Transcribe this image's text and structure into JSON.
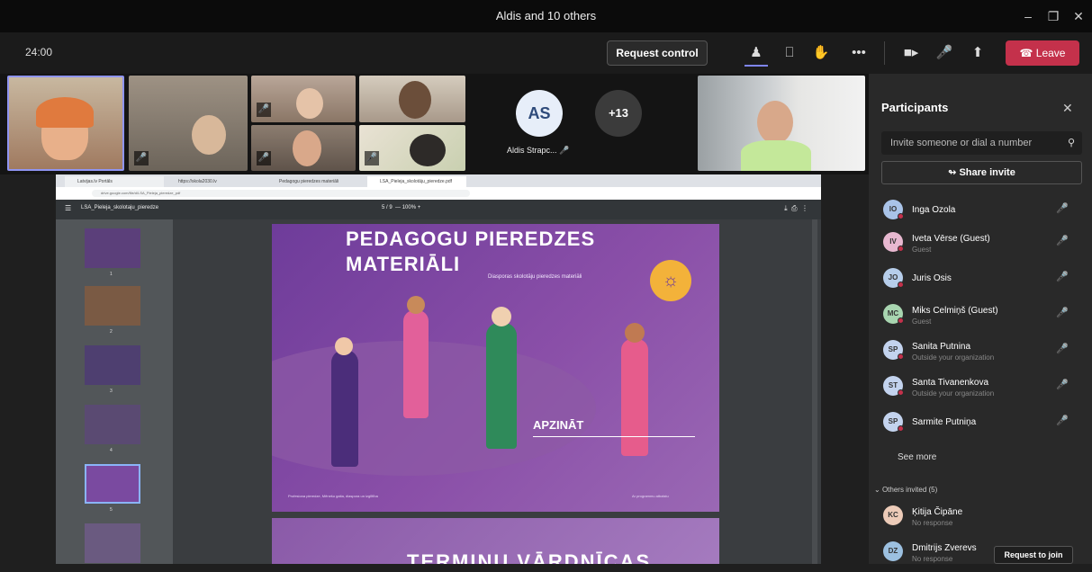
{
  "window": {
    "title": "Aldis and 10 others"
  },
  "toolbar": {
    "timer": "24:00",
    "request_control": "Request control",
    "leave": "Leave"
  },
  "videos": {
    "avatar_initials": "AS",
    "avatar_name": "Aldis Strapc...",
    "overflow_count": "+13"
  },
  "share": {
    "tabs": [
      "Latvijas.lv Portāls",
      "https://skola2030.lv",
      "Pedagogu pieredzes materiāli",
      "LSA_Pieleja_skolotāju_pieredze.pdf"
    ],
    "address": "drive.google.com/file/d/LSA_Pieleja_pieredze_pdf",
    "pdf_name": "LSA_Pieleja_skolotaju_pieredze",
    "page_indicator": "5 / 9",
    "zoom": "100%",
    "thumb_numbers": [
      "1",
      "2",
      "3",
      "4",
      "5"
    ],
    "slide_title_1": "PEDAGOGU PIEREDZES",
    "slide_title_2": "MATERIĀLI",
    "slide_subtitle": "Diasporas skolotāju pieredzes materiāli",
    "slide_keyword": "APZINĀT",
    "slide_footer_left": "Profesiona pieredze, Mēnešu gaita, diaspora un izglītība",
    "slide_footer_right": "Ar programmu atbalstu",
    "next_slide_title": "TERMINU VĀRDNĪCAS"
  },
  "panel": {
    "title": "Participants",
    "invite_placeholder": "Invite someone or dial a number",
    "share_invite": "Share invite",
    "participants": [
      {
        "initials": "IO",
        "name": "Inga Ozola",
        "sub": "",
        "color": "#a9c3e8"
      },
      {
        "initials": "IV",
        "name": "Iveta Vērse (Guest)",
        "sub": "Guest",
        "color": "#e8b8d0"
      },
      {
        "initials": "JO",
        "name": "Juris Osis",
        "sub": "",
        "color": "#b6cdea"
      },
      {
        "initials": "MC",
        "name": "Miks Celmiņš (Guest)",
        "sub": "Guest",
        "color": "#a8d5b0"
      },
      {
        "initials": "SP",
        "name": "Sanita Putnina",
        "sub": "Outside your organization",
        "color": "#c3d3ee"
      },
      {
        "initials": "ST",
        "name": "Santa Tivanenkova",
        "sub": "Outside your organization",
        "color": "#c3d3ee"
      },
      {
        "initials": "SP",
        "name": "Sarmite Putniņa",
        "sub": "",
        "color": "#c3d3ee"
      }
    ],
    "see_more": "See more",
    "others_invited": "Others invited (5)",
    "invited": [
      {
        "initials": "KC",
        "name": "Ķitija Čipāne",
        "sub": "No response",
        "color": "#eccbb8"
      },
      {
        "initials": "DZ",
        "name": "Dmitrijs Zverevs",
        "sub": "No response",
        "color": "#9cc0e0"
      }
    ],
    "request_to_join": "Request to join"
  }
}
